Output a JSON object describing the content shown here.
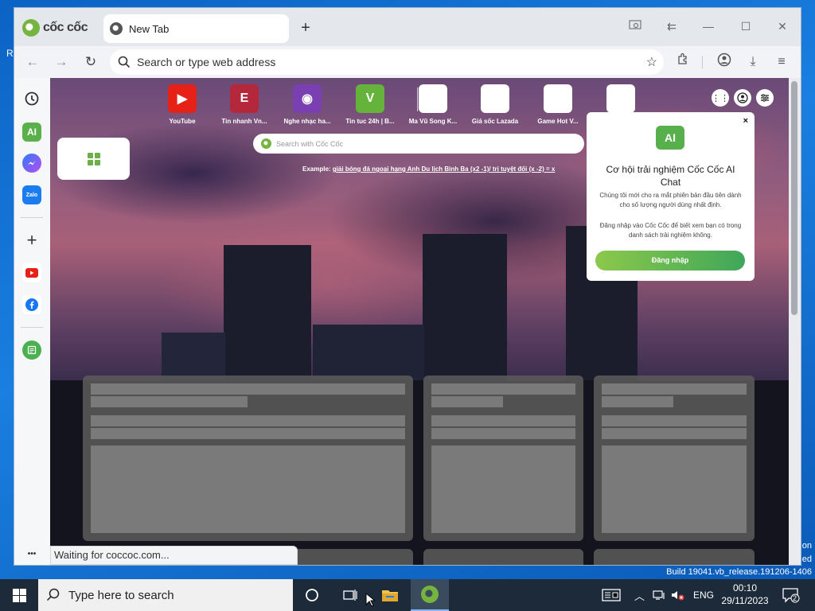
{
  "desktop": {
    "left_text": "R",
    "right_text_1": "on",
    "right_text_2": "ed",
    "build": "Build 19041.vb_release.191206-1406"
  },
  "browser": {
    "logo_text": "cốc cốc",
    "tab_title": "New Tab",
    "omnibox_placeholder": "Search or type web address"
  },
  "speed_dial": [
    {
      "label": "YouTube",
      "color": "#e62117",
      "glyph": "▶"
    },
    {
      "label": "Tin nhanh Vn...",
      "color": "#b5273a",
      "glyph": "E"
    },
    {
      "label": "Nghe nhạc ha...",
      "color": "#7a3fb0",
      "glyph": "◉"
    },
    {
      "label": "Tin tuc 24h | B...",
      "color": "#65b33a",
      "glyph": "V"
    },
    {
      "label": "Ma Vũ Song K...",
      "color": "#ffffff",
      "glyph": ""
    },
    {
      "label": "Giá sốc Lazada",
      "color": "#ffffff",
      "glyph": ""
    },
    {
      "label": "Game Hot V...",
      "color": "#ffffff",
      "glyph": ""
    },
    {
      "label": "",
      "color": "#ffffff",
      "glyph": ""
    }
  ],
  "newtab": {
    "search_placeholder": "Search with Cốc Cốc",
    "example_prefix": "Example:",
    "example_links": "giải bóng đá ngoại hạng Anh Du lịch Bình Ba (x2 -1)/ trị tuyệt đối (x -2) = x"
  },
  "popup": {
    "badge": "AI",
    "title": "Cơ hội trải nghiệm Cốc Cốc AI Chat",
    "body_1": "Chúng tôi mới cho ra mắt phiên bản đầu tiên dành cho số lượng người dùng nhất định.",
    "body_2": "Đăng nhập vào Cốc Cốc để biết xem bạn có trong danh sách trải nghiệm không.",
    "button": "Đăng nhập",
    "close": "×"
  },
  "sidebar": {
    "ai_label": "AI",
    "zalo_label": "Zalo",
    "more": "•••"
  },
  "status_text": "Waiting for coccoc.com...",
  "taskbar": {
    "search_placeholder": "Type here to search",
    "lang": "ENG",
    "time": "00:10",
    "date": "29/11/2023",
    "notif_count": "2"
  }
}
